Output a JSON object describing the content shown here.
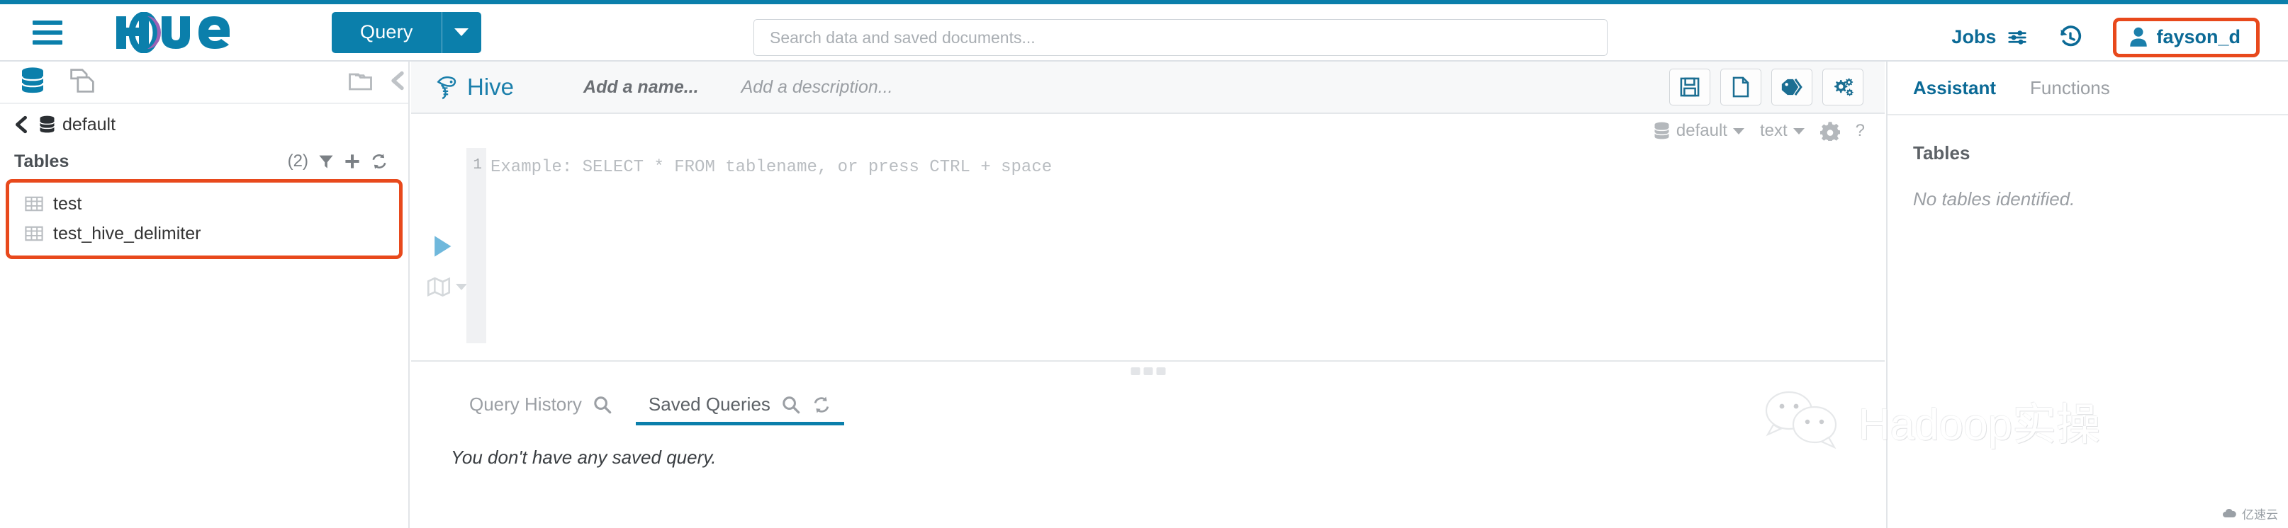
{
  "header": {
    "menu_icon": "hamburger-icon",
    "logo_text": "Hue",
    "query_button": {
      "label": "Query",
      "caret": "chevron-down-icon"
    },
    "search": {
      "value": "",
      "placeholder": "Search data and saved documents..."
    },
    "jobs": {
      "label": "Jobs",
      "icon": "sliders-icon"
    },
    "history": {
      "icon": "clock-rotate-left-icon"
    },
    "user": {
      "name": "fayson_d",
      "icon": "user-icon",
      "highlight_color": "#E8491C"
    }
  },
  "left_sidebar": {
    "icon_row": {
      "database_icon": "database-icon",
      "documents_icon": "documents-icon",
      "folder_icon": "folder-open-icon",
      "collapse_icon": "chevron-left-icon"
    },
    "breadcrumb": {
      "back_icon": "chevron-left-icon",
      "db_icon": "database-icon",
      "label": "default"
    },
    "tables_header": {
      "title": "Tables",
      "count": "(2)",
      "filter_icon": "filter-icon",
      "add_icon": "plus-icon",
      "refresh_icon": "refresh-icon"
    },
    "tables": [
      {
        "name": "test",
        "icon": "table-icon"
      },
      {
        "name": "test_hive_delimiter",
        "icon": "table-icon"
      }
    ],
    "tables_highlight_color": "#E8491C"
  },
  "editor": {
    "engine": {
      "label": "Hive",
      "icon": "hive-bee-icon"
    },
    "name_placeholder": "Add a name...",
    "description_placeholder": "Add a description...",
    "toolbar_buttons": [
      {
        "name": "save-button",
        "icon": "floppy-save-icon"
      },
      {
        "name": "new-document-button",
        "icon": "file-blank-icon"
      },
      {
        "name": "tag-button",
        "icon": "tag-icon"
      },
      {
        "name": "settings-button",
        "icon": "gears-icon"
      }
    ],
    "subbar": {
      "database": {
        "label": "default",
        "icon": "database-icon",
        "caret": "chevron-down-icon"
      },
      "result_format": {
        "label": "text",
        "caret": "chevron-down-icon"
      },
      "gear_icon": "gear-icon",
      "help_icon": "question-mark-icon"
    },
    "run_button_icon": "play-triangle-icon",
    "fold_button_icon": "map-fold-icon",
    "fold_caret_icon": "chevron-down-icon",
    "line_number": "1",
    "code_placeholder": "Example: SELECT * FROM tablename, or press CTRL + space",
    "splitter_icon": "drag-dots-handle"
  },
  "results": {
    "tabs": [
      {
        "label": "Query History",
        "icon": "search-icon",
        "active": false
      },
      {
        "label": "Saved Queries",
        "icon": "search-icon",
        "extra_icon": "refresh-icon",
        "active": true
      }
    ],
    "empty_message": "You don't have any saved query.",
    "active_underline_color": "#0B7FAB"
  },
  "right_panel": {
    "tabs": [
      {
        "label": "Assistant",
        "active": true
      },
      {
        "label": "Functions",
        "active": false
      }
    ],
    "section_title": "Tables",
    "empty_message": "No tables identified."
  },
  "watermark": {
    "text": "Hadoop实操",
    "icon": "wechat-bubbles-icon"
  },
  "brandmark": {
    "text": "亿速云",
    "icon": "cloud-icon"
  },
  "theme": {
    "accent": "#0B7FAB",
    "accent_dark": "#0B6A96",
    "highlight": "#E8491C"
  }
}
